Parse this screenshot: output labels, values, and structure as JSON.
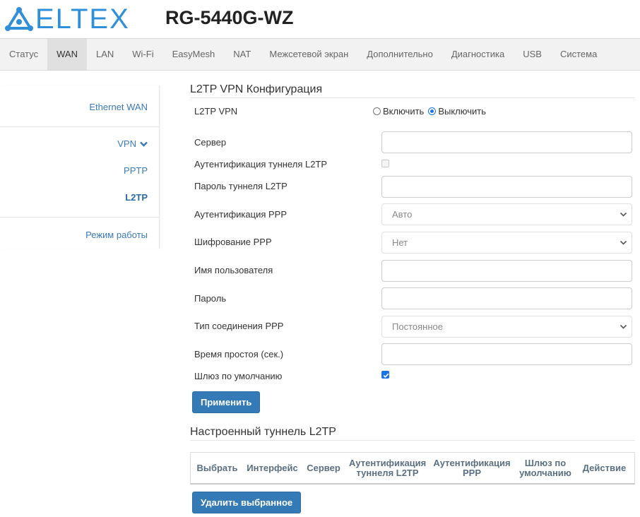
{
  "header": {
    "brand": "ELTEX",
    "model": "RG-5440G-WZ",
    "brand_color": "#2f8fd8"
  },
  "nav": {
    "items": [
      "Статус",
      "WAN",
      "LAN",
      "Wi-Fi",
      "EasyMesh",
      "NAT",
      "Межсетевой экран",
      "Дополнительно",
      "Диагностика",
      "USB",
      "Система"
    ],
    "active": "WAN"
  },
  "sidebar": {
    "ethernet_wan": "Ethernet WAN",
    "vpn": "VPN",
    "pptp": "PPTP",
    "l2tp": "L2TP",
    "mode": "Режим работы"
  },
  "config": {
    "title": "L2TP VPN Конфигурация",
    "l2tp_vpn_label": "L2TP VPN",
    "enable_label": "Включить",
    "disable_label": "Выключить",
    "selected": "Выключить",
    "server_label": "Сервер",
    "server_value": "",
    "tunnel_auth_label": "Аутентификация туннеля L2TP",
    "tunnel_auth_checked": false,
    "tunnel_password_label": "Пароль туннеля L2TP",
    "tunnel_password_value": "",
    "ppp_auth_label": "Аутентификация PPP",
    "ppp_auth_value": "Авто",
    "ppp_encryption_label": "Шифрование PPP",
    "ppp_encryption_value": "Нет",
    "username_label": "Имя пользователя",
    "username_value": "",
    "password_label": "Пароль",
    "password_value": "",
    "conn_type_label": "Тип соединения PPP",
    "conn_type_value": "Постоянное",
    "idle_time_label": "Время простоя (сек.)",
    "idle_time_value": "",
    "default_gw_label": "Шлюз по умолчанию",
    "default_gw_checked": true,
    "apply_label": "Применить"
  },
  "tunnels": {
    "title": "Настроенный туннель L2TP",
    "columns": [
      "Выбрать",
      "Интерфейс",
      "Сервер",
      "Аутентификация туннеля L2TP",
      "Аутентификация PPP",
      "Шлюз по умолчанию",
      "Действие"
    ],
    "delete_label": "Удалить выбранное"
  },
  "colors": {
    "accent": "#337ab7",
    "link": "#3a7ab8",
    "header_text": "#5a6f82"
  }
}
